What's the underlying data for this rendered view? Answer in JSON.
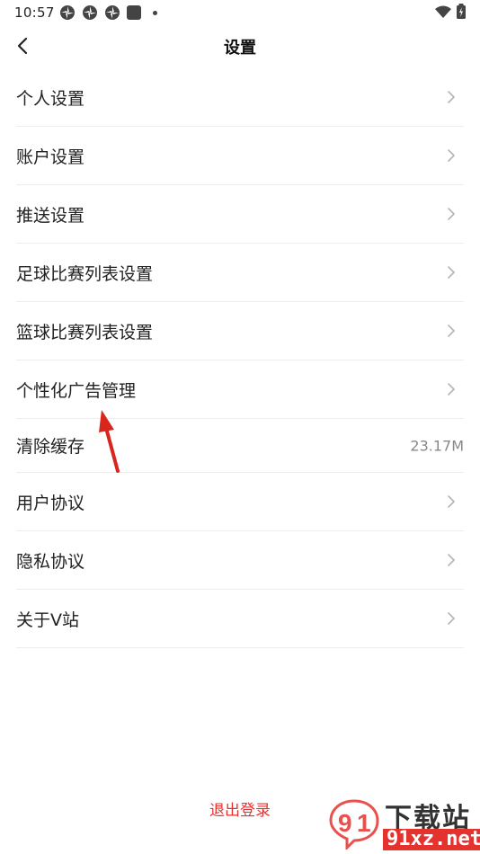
{
  "status_bar": {
    "time": "10:57"
  },
  "header": {
    "title": "设置"
  },
  "settings": {
    "items": [
      {
        "label": "个人设置",
        "value": null,
        "has_chevron": true
      },
      {
        "label": "账户设置",
        "value": null,
        "has_chevron": true
      },
      {
        "label": "推送设置",
        "value": null,
        "has_chevron": true
      },
      {
        "label": "足球比赛列表设置",
        "value": null,
        "has_chevron": true
      },
      {
        "label": "篮球比赛列表设置",
        "value": null,
        "has_chevron": true
      },
      {
        "label": "个性化广告管理",
        "value": null,
        "has_chevron": true
      },
      {
        "label": "清除缓存",
        "value": "23.17M",
        "has_chevron": false
      },
      {
        "label": "用户协议",
        "value": null,
        "has_chevron": true
      },
      {
        "label": "隐私协议",
        "value": null,
        "has_chevron": true
      },
      {
        "label": "关于V站",
        "value": null,
        "has_chevron": true
      }
    ]
  },
  "logout": {
    "label": "退出登录"
  },
  "watermark": {
    "name": "下载站",
    "domain": "91xz.net"
  },
  "colors": {
    "logout": "#e4322f",
    "arrow": "#d9261c",
    "chevron": "#b5b5b5",
    "divider": "#eeeeee"
  }
}
